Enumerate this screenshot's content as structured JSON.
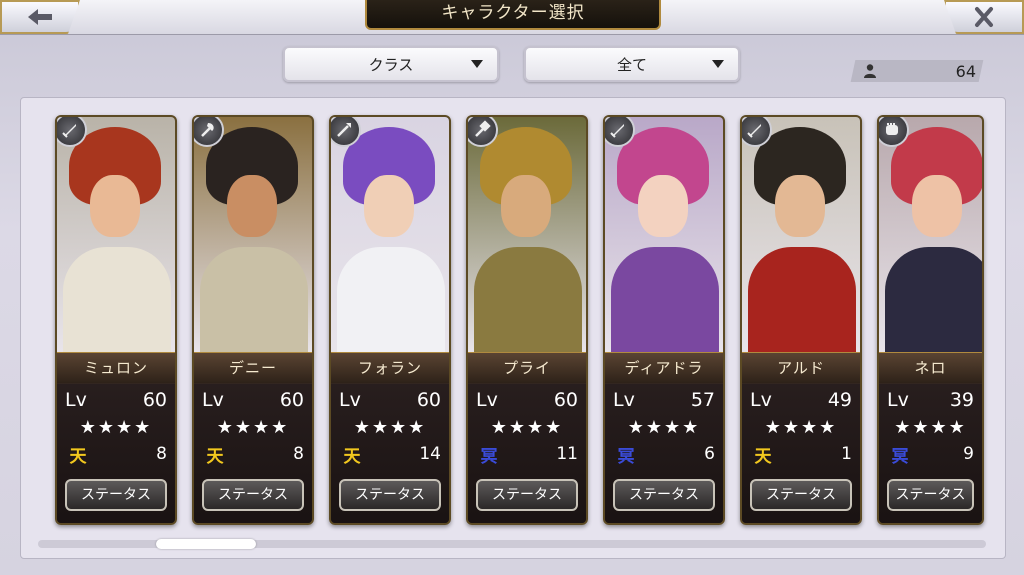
{
  "header": {
    "title": "キャラクター選択"
  },
  "filters": {
    "class_label": "クラス",
    "scope_label": "全て"
  },
  "count": {
    "value": "64"
  },
  "cards": [
    {
      "name": "ミュロン",
      "lv_label": "Lv",
      "level": "60",
      "stars": "★★★★",
      "rank": "天",
      "rank_type": "gold",
      "count": "8",
      "status": "ステータス",
      "weapon": "sword-icon"
    },
    {
      "name": "デニー",
      "lv_label": "Lv",
      "level": "60",
      "stars": "★★★★",
      "rank": "天",
      "rank_type": "gold",
      "count": "8",
      "status": "ステータス",
      "weapon": "axe-icon"
    },
    {
      "name": "フォラン",
      "lv_label": "Lv",
      "level": "60",
      "stars": "★★★★",
      "rank": "天",
      "rank_type": "gold",
      "count": "14",
      "status": "ステータス",
      "weapon": "spear-icon"
    },
    {
      "name": "プライ",
      "lv_label": "Lv",
      "level": "60",
      "stars": "★★★★",
      "rank": "冥",
      "rank_type": "blue",
      "count": "11",
      "status": "ステータス",
      "weapon": "hammer-icon"
    },
    {
      "name": "ディアドラ",
      "lv_label": "Lv",
      "level": "57",
      "stars": "★★★★",
      "rank": "冥",
      "rank_type": "blue",
      "count": "6",
      "status": "ステータス",
      "weapon": "sword-icon"
    },
    {
      "name": "アルド",
      "lv_label": "Lv",
      "level": "49",
      "stars": "★★★★",
      "rank": "天",
      "rank_type": "gold",
      "count": "1",
      "status": "ステータス",
      "weapon": "sword-icon"
    },
    {
      "name": "ネロ",
      "lv_label": "Lv",
      "level": "39",
      "stars": "★★★★",
      "rank": "冥",
      "rank_type": "blue",
      "count": "9",
      "status": "ステータス",
      "weapon": "fist-icon"
    }
  ],
  "colors": {
    "gold": "#f2c81e",
    "blue": "#3a4bd8"
  }
}
